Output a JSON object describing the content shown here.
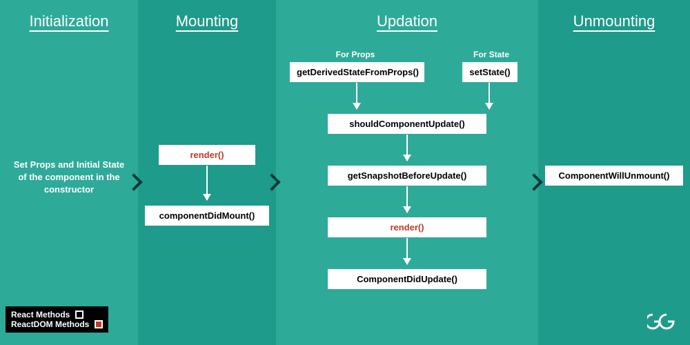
{
  "phases": {
    "initialization": {
      "title": "Initialization",
      "description": "Set Props and Initial State of the component in the constructor"
    },
    "mounting": {
      "title": "Mounting",
      "render": "render()",
      "didMount": "componentDidMount()"
    },
    "updation": {
      "title": "Updation",
      "forProps": "For Props",
      "forState": "For State",
      "getDerived": "getDerivedStateFromProps()",
      "setState": "setState()",
      "shouldUpdate": "shouldComponentUpdate()",
      "getSnapshot": "getSnapshotBeforeUpdate()",
      "render": "render()",
      "didUpdate": "ComponentDidUpdate()"
    },
    "unmounting": {
      "title": "Unmounting",
      "willUnmount": "ComponentWillUnmount()"
    }
  },
  "legend": {
    "react": "React Methods",
    "reactDom": "ReactDOM Methods"
  },
  "logo": "GG"
}
